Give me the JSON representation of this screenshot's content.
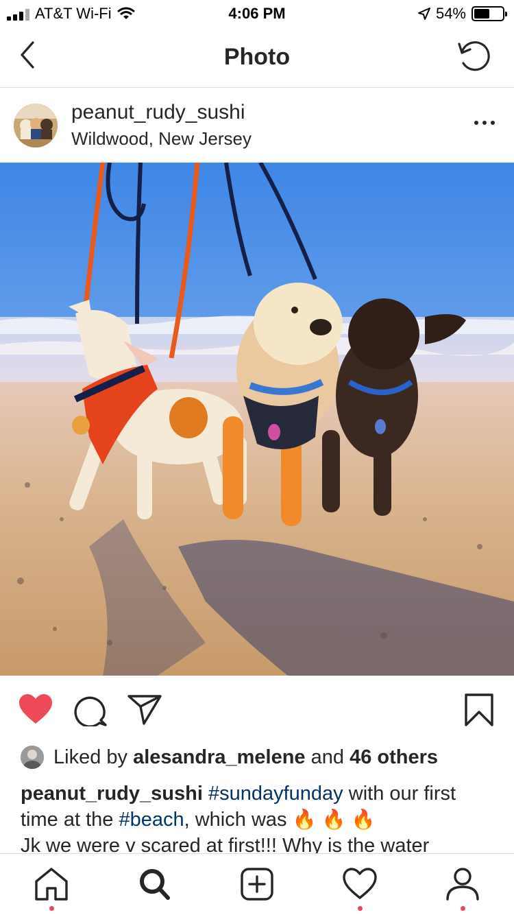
{
  "status_bar": {
    "carrier": "AT&T Wi-Fi",
    "time": "4:06 PM",
    "battery": "54%",
    "battery_level": 0.54
  },
  "nav": {
    "title": "Photo",
    "back_icon": "chevron-left-icon",
    "refresh_icon": "refresh-icon"
  },
  "post": {
    "username": "peanut_rudy_sushi",
    "location": "Wildwood, New Jersey",
    "more_icon": "ellipsis-icon",
    "liked": true,
    "likes": {
      "prefix": "Liked by",
      "liker": "alesandra_melene",
      "connector": "and",
      "others": "46 others"
    },
    "caption": {
      "username": "peanut_rudy_sushi",
      "tag1": "#sundayfunday",
      "text1": "with our first time at the",
      "tag2": "#beach",
      "text2": ", which was",
      "emoji": "🔥",
      "line3": "Jk we were v scared at first!!! Why is the water"
    }
  },
  "colors": {
    "like_red": "#ed4956",
    "hashtag": "#003569",
    "text": "#262626",
    "divider": "#dbdbdb"
  },
  "tabs": [
    {
      "icon": "home-icon",
      "has_dot": true
    },
    {
      "icon": "search-icon",
      "has_dot": false
    },
    {
      "icon": "add-post-icon",
      "has_dot": false
    },
    {
      "icon": "heart-activity-icon",
      "has_dot": true
    },
    {
      "icon": "profile-icon",
      "has_dot": true
    }
  ]
}
